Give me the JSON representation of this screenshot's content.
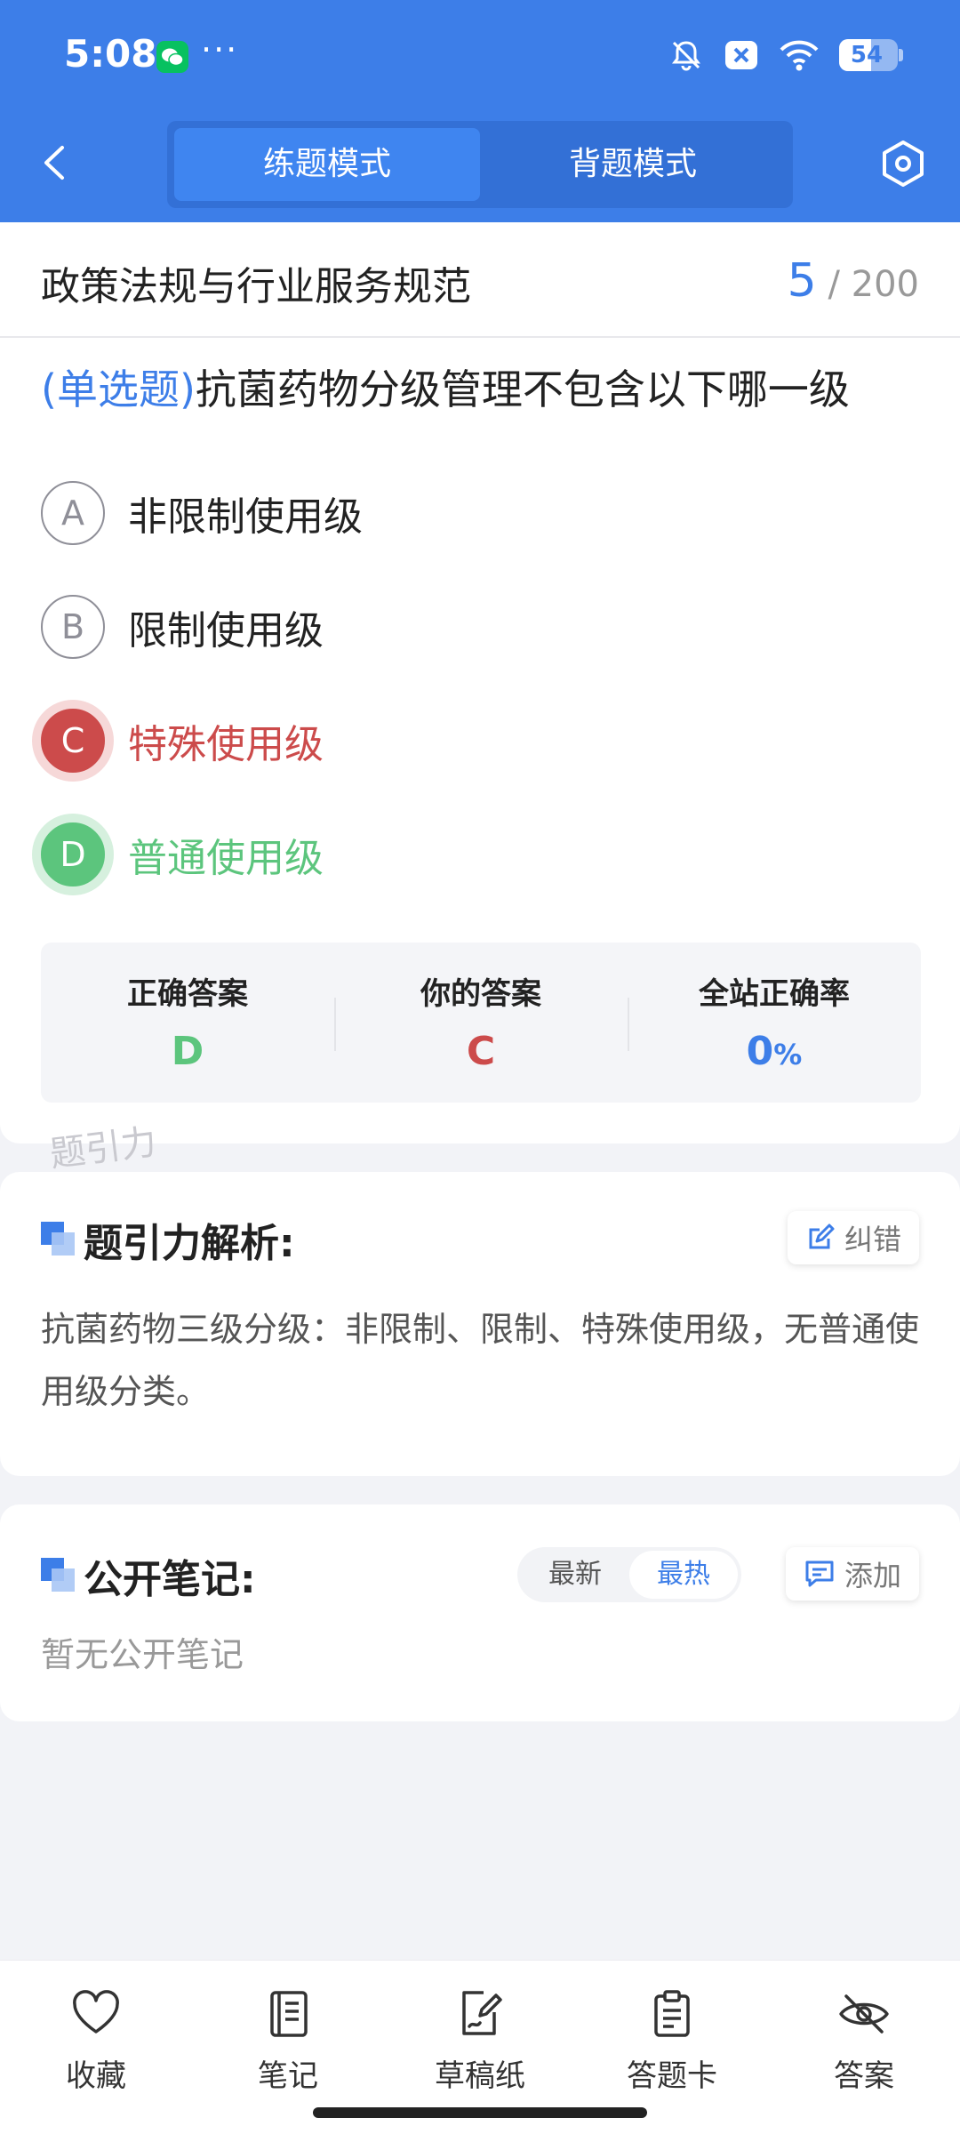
{
  "status_bar": {
    "time": "5:08",
    "dots": "···",
    "battery": "54"
  },
  "header": {
    "tabs": [
      {
        "label": "练题模式",
        "active": true
      },
      {
        "label": "背题模式",
        "active": false
      }
    ]
  },
  "question_card": {
    "category": "政策法规与行业服务规范",
    "current": "5",
    "total": "/ 200",
    "question_type": "(单选题)",
    "question_text": "抗菌药物分级管理不包含以下哪一级",
    "options": [
      {
        "letter": "A",
        "text": "非限制使用级",
        "state": "default"
      },
      {
        "letter": "B",
        "text": "限制使用级",
        "state": "default"
      },
      {
        "letter": "C",
        "text": "特殊使用级",
        "state": "wrong"
      },
      {
        "letter": "D",
        "text": "普通使用级",
        "state": "right"
      }
    ],
    "stats": [
      {
        "label": "正确答案",
        "value": "D",
        "color": "#5cc57d"
      },
      {
        "label": "你的答案",
        "value": "C",
        "color": "#cc4b4b"
      },
      {
        "label": "全站正确率",
        "value": "0",
        "unit": "%",
        "color": "#3d7ee8"
      }
    ]
  },
  "watermark": "题引力",
  "analysis": {
    "title": "题引力解析:",
    "correct_button": "纠错",
    "text": "抗菌药物三级分级：非限制、限制、特殊使用级，无普通使用级分类。"
  },
  "notes": {
    "title": "公开笔记:",
    "sort_options": [
      {
        "label": "最新",
        "active": false
      },
      {
        "label": "最热",
        "active": true
      }
    ],
    "add_button": "添加",
    "empty_text": "暂无公开笔记"
  },
  "bottom_nav": [
    {
      "label": "收藏",
      "icon": "heart-icon"
    },
    {
      "label": "笔记",
      "icon": "notebook-icon"
    },
    {
      "label": "草稿纸",
      "icon": "draft-paper-icon"
    },
    {
      "label": "答题卡",
      "icon": "answer-sheet-icon"
    },
    {
      "label": "答案",
      "icon": "eye-off-icon"
    }
  ],
  "colors": {
    "primary": "#3d7ee8",
    "wrong": "#cc4b4b",
    "right": "#5cc57d"
  }
}
